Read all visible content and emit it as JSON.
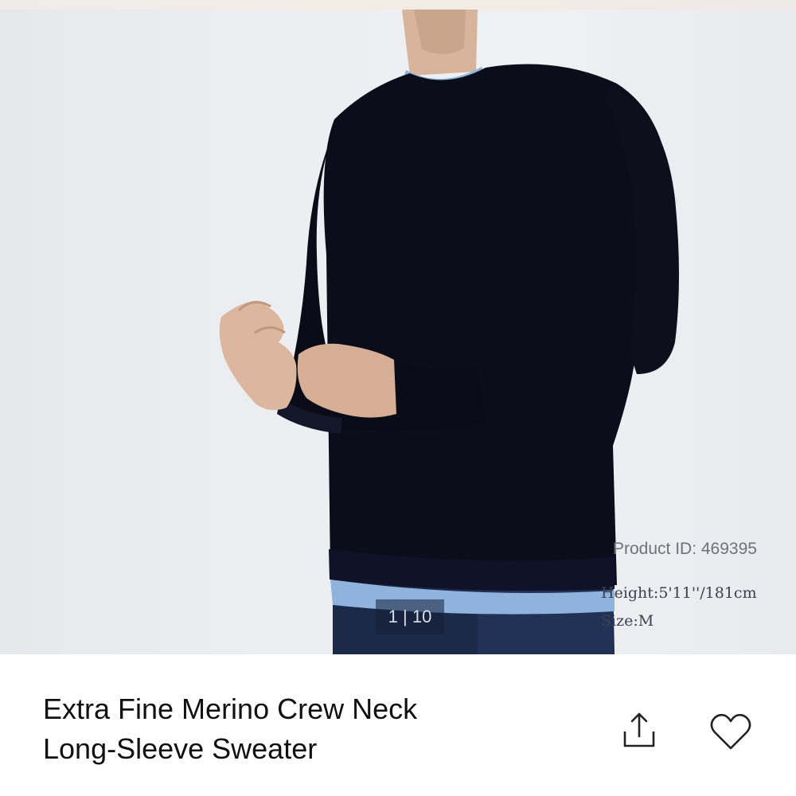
{
  "gallery": {
    "counter": "1 | 10",
    "overlay": {
      "product_id": "Product ID: 469395",
      "model_height": "Height:5'11''/181cm",
      "model_size": "Size:M"
    }
  },
  "product": {
    "title_line1": "Extra Fine Merino Crew Neck",
    "title_line2": "Long-Sleeve Sweater"
  },
  "icons": {
    "share": "share-icon",
    "favorite": "heart-icon"
  },
  "colors": {
    "sweater": "#0b0d1a",
    "undershirt": "#8fb3dc",
    "jeans": "#1c2a4a",
    "title_text": "#111111"
  }
}
